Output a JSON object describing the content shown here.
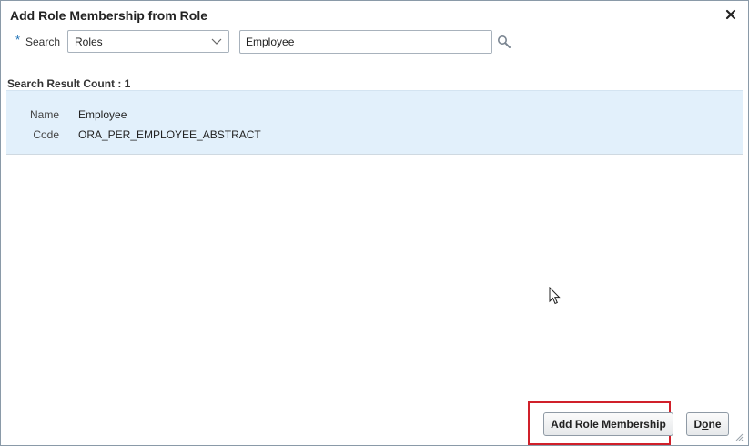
{
  "dialog": {
    "title": "Add Role Membership from Role",
    "close_icon": "close-icon"
  },
  "search": {
    "required_marker": "*",
    "label": "Search",
    "type_select": {
      "selected": "Roles",
      "icon": "chevron-down-icon"
    },
    "query": "Employee",
    "search_icon": "search-icon"
  },
  "results": {
    "count_text": "Search Result Count : 1",
    "items": [
      {
        "name_label": "Name",
        "name_value": "Employee",
        "code_label": "Code",
        "code_value": "ORA_PER_EMPLOYEE_ABSTRACT"
      }
    ]
  },
  "footer": {
    "add_button_label": "Add Role Membership",
    "done_button_label": "Done",
    "done_mnemonic": "o"
  },
  "colors": {
    "selected_row_bg": "#e2f0fb",
    "highlight_border": "#d0202a",
    "required_marker": "#1a6fb5"
  }
}
